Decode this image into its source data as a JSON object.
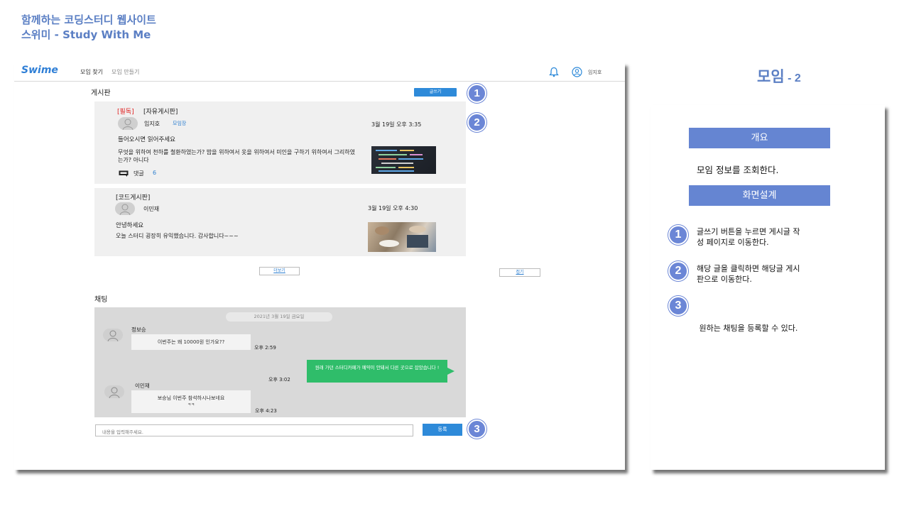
{
  "heading": {
    "line1": "함께하는 코딩스터디 웹사이트",
    "line2": "스위미 - Study With Me"
  },
  "nav": {
    "logo": "Swime",
    "links": [
      "모임 찾기",
      "모임 만들기"
    ],
    "user_name": "임지호",
    "icons": [
      "bell-icon",
      "user-circle-icon"
    ]
  },
  "board": {
    "label": "게시판",
    "write_button": "글쓰기",
    "posts": [
      {
        "notice": "[필독]",
        "tag": "[자유게시판]",
        "author": "임지호",
        "role": "모임장",
        "date": "3월 19일 오후 3:35",
        "title": "들어오시면 읽어주세요",
        "body": "무엇을 위하여 천하를 철환하였는가? 밥을 위하여서 옷을 위하여서 미인을 구하기 위하여서 그리하였는가? 아니다",
        "comment_label": "댓글",
        "comment_count": "6"
      },
      {
        "tag": "[코드게시판]",
        "author": "이민재",
        "date": "3월 19일 오후 4:30",
        "title": "안녕하세요",
        "body": "오늘 스터디 굉장히 유익했습니다. 감사합니다~~~"
      }
    ],
    "more_button": "더보기",
    "fold_button": "접기"
  },
  "chat": {
    "label": "채팅",
    "date_pill": "2021년 3월 19일 금요일",
    "messages": [
      {
        "name": "정보승",
        "text": "이번주는 왜 10000원 인가요??",
        "time": "오후 2:59"
      },
      {
        "text": "원래 가던 스터디카페가 예약이 안돼서 다른 곳으로 잡았습니다 !",
        "time": "오후 3:02",
        "mine": true
      },
      {
        "name": "이민재",
        "text": "보승님 이번주 참석하시나보네요",
        "text2": "ㅋㅋ",
        "time": "오후 4:23"
      }
    ],
    "input_placeholder": "내용을 입력해주세요.",
    "send_button": "등록"
  },
  "markers": [
    "1",
    "2",
    "3"
  ],
  "description": {
    "title": "모임",
    "title_suffix": "- 2",
    "overview_label": "개요",
    "overview_text": "모임 정보를 조회한다.",
    "design_label": "화면설계",
    "items": [
      {
        "num": "1",
        "line1": "글쓰기 버튼을 누르면 게시글 작",
        "line2": "성 페이지로 이동한다."
      },
      {
        "num": "2",
        "line1": "해당 글을 클릭하면 해당글 게시",
        "line2": "판으로 이동한다."
      },
      {
        "num": "3",
        "line1": " 원하는 채팅을 등록할 수 있다.",
        "line2": ""
      }
    ]
  },
  "colors": {
    "accent": "#5b7fc4",
    "marker": "#6b86d6",
    "primary_button": "#2e8ad9",
    "chat_green": "#2fbd6a",
    "notice_red": "#e02020"
  }
}
